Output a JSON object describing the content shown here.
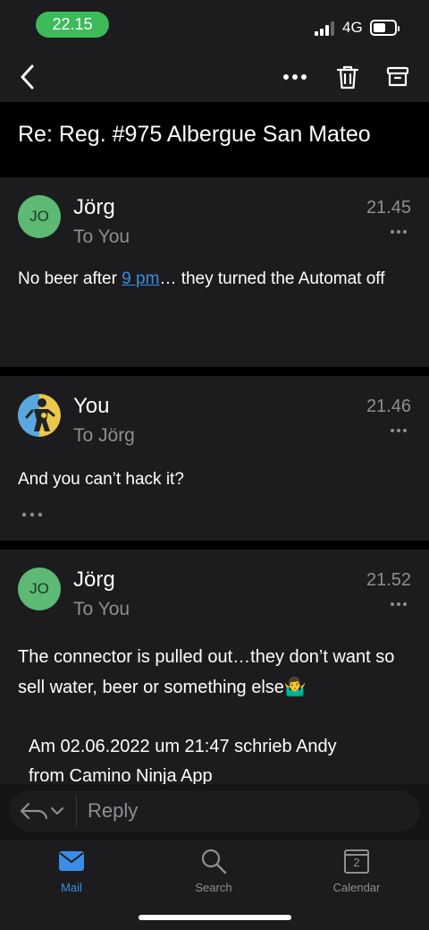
{
  "status_bar": {
    "time": "22.15",
    "network": "4G"
  },
  "header": {
    "subject": "Re: Reg. #975 Albergue San Mateo"
  },
  "messages": [
    {
      "avatar_initials": "JO",
      "sender": "Jörg",
      "recipient": "To You",
      "time": "21.45",
      "body_prefix": "No beer after ",
      "body_link": "9 pm",
      "body_suffix": "… they turned the Automat off"
    },
    {
      "sender": "You",
      "recipient": "To Jörg",
      "time": "21.46",
      "body": "And you can’t hack it?"
    },
    {
      "avatar_initials": "JO",
      "sender": "Jörg",
      "recipient": "To You",
      "time": "21.52",
      "body": "The connector is pulled out…they don’t want so sell water, beer or something else🤷‍♂️",
      "quote_line1": "Am 02.06.2022 um 21:47 schrieb Andy",
      "quote_line2": "from Camino Ninja App"
    }
  ],
  "reply": {
    "placeholder": "Reply"
  },
  "tabs": [
    {
      "label": "Mail",
      "icon": "mail-icon",
      "active": true
    },
    {
      "label": "Search",
      "icon": "search-icon",
      "active": false
    },
    {
      "label": "Calendar",
      "icon": "calendar-icon",
      "active": false,
      "badge": "2"
    }
  ],
  "colors": {
    "accent": "#3a8de6",
    "time_pill": "#3dba5a",
    "avatar": "#5db974"
  }
}
